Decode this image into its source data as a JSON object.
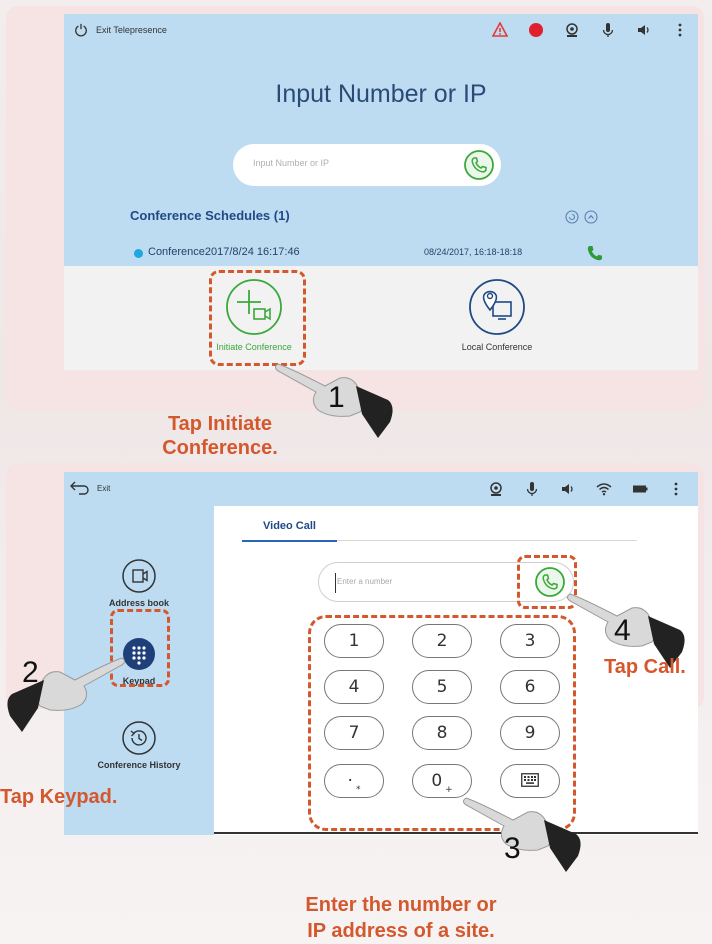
{
  "screen1": {
    "exit_label": "Exit Telepresence",
    "title": "Input Number or IP",
    "input_placeholder": "Input Number or IP",
    "schedules_title": "Conference Schedules (1)",
    "schedule": {
      "name": "Conference2017/8/24 16:17:46",
      "time": "08/24/2017, 16:18-18:18"
    },
    "options": [
      {
        "label": "Initiate Conference",
        "icon": "add-video-icon"
      },
      {
        "label": "Local Conference",
        "icon": "location-screen-icon"
      }
    ],
    "status_icons": [
      "warning-icon",
      "record-icon",
      "camera-icon",
      "mic-icon",
      "speaker-icon",
      "more-icon"
    ]
  },
  "screen2": {
    "exit_label": "Exit",
    "tab_label": "Video Call",
    "input_placeholder": "Enter a number",
    "sidebar": [
      {
        "label": "Address book",
        "icon": "address-book-icon"
      },
      {
        "label": "Keypad",
        "icon": "keypad-icon"
      },
      {
        "label": "Conference History",
        "icon": "history-icon"
      }
    ],
    "keys": [
      {
        "main": "1",
        "sub": ""
      },
      {
        "main": "2",
        "sub": ""
      },
      {
        "main": "3",
        "sub": ""
      },
      {
        "main": "4",
        "sub": ""
      },
      {
        "main": "5",
        "sub": ""
      },
      {
        "main": "6",
        "sub": ""
      },
      {
        "main": "7",
        "sub": ""
      },
      {
        "main": "8",
        "sub": ""
      },
      {
        "main": "9",
        "sub": ""
      },
      {
        "main": "·",
        "sub": "*"
      },
      {
        "main": "0",
        "sub": "+"
      },
      {
        "main": "",
        "sub": ""
      }
    ],
    "status_icons": [
      "camera-icon",
      "mic-icon",
      "speaker-icon",
      "wifi-icon",
      "battery-icon",
      "more-icon"
    ]
  },
  "annotations": {
    "step1": "1",
    "step2": "2",
    "step3": "3",
    "step4": "4",
    "tap_initiate_line1": "Tap Initiate",
    "tap_initiate_line2": "Conference.",
    "tap_keypad": "Tap Keypad.",
    "tap_call": "Tap Call.",
    "enter_line1": "Enter the number or",
    "enter_line2": "IP address of a site."
  },
  "colors": {
    "accent_orange": "#d4582e",
    "screen_blue": "#bddcf2",
    "title_blue": "#2a4a78",
    "green": "#3ba83b"
  }
}
